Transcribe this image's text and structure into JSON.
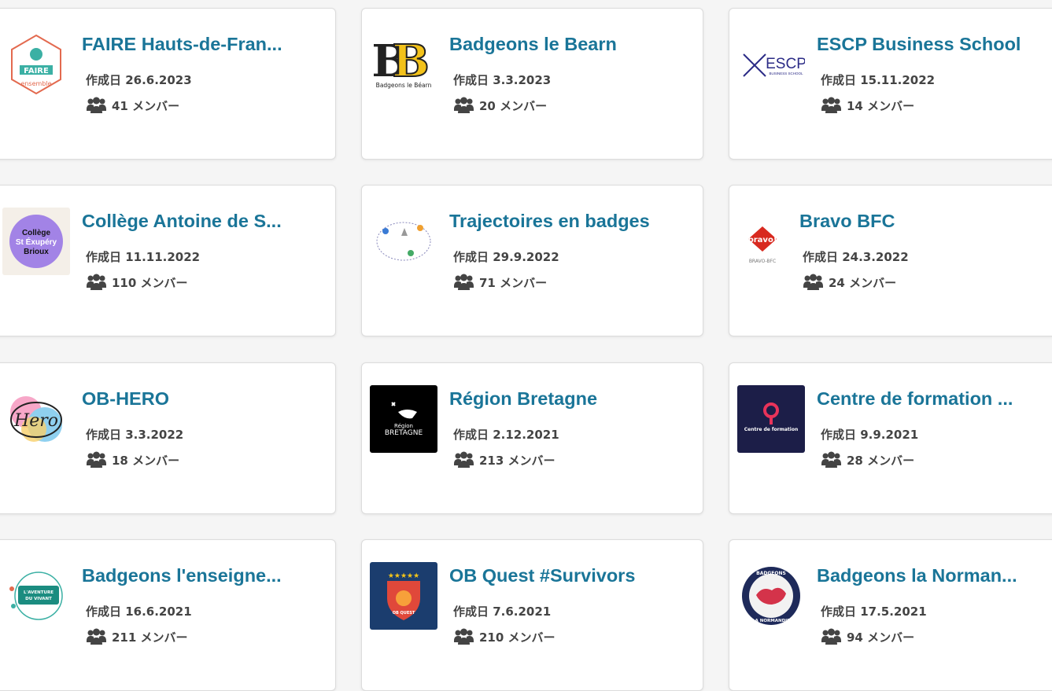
{
  "cards": [
    {
      "title": "FAIRE Hauts-de-Fran...",
      "date": "作成日 26.6.2023",
      "members": "41 メンバー",
      "logo_icon": "faire-logo-icon",
      "logo_text": "FAIRE",
      "logo_sub": "ensemble"
    },
    {
      "title": "Badgeons le Bearn",
      "date": "作成日 3.3.2023",
      "members": "20 メンバー",
      "logo_icon": "bb-logo-icon",
      "logo_text": "BB",
      "logo_sub": "Badgeons le Béarn"
    },
    {
      "title": "ESCP Business School",
      "date": "作成日 15.11.2022",
      "members": "14 メンバー",
      "logo_icon": "escp-logo-icon",
      "logo_text": "ESCP",
      "logo_sub": "BUSINESS SCHOOL"
    },
    {
      "title": "Collège Antoine de S...",
      "date": "作成日 11.11.2022",
      "members": "110 メンバー",
      "logo_icon": "college-logo-icon",
      "logo_text": "Collège St Exupéry Brioux",
      "logo_sub": ""
    },
    {
      "title": "Trajectoires en badges",
      "date": "作成日 29.9.2022",
      "members": "71 メンバー",
      "logo_icon": "trajectoires-logo-icon",
      "logo_text": "",
      "logo_sub": ""
    },
    {
      "title": "Bravo BFC",
      "date": "作成日 24.3.2022",
      "members": "24 メンバー",
      "logo_icon": "bravo-logo-icon",
      "logo_text": "bravo!",
      "logo_sub": "BRAVO-BFC"
    },
    {
      "title": "OB-HERO",
      "date": "作成日 3.3.2022",
      "members": "18 メンバー",
      "logo_icon": "hero-logo-icon",
      "logo_text": "Hero",
      "logo_sub": ""
    },
    {
      "title": "Région Bretagne",
      "date": "作成日 2.12.2021",
      "members": "213 メンバー",
      "logo_icon": "bretagne-logo-icon",
      "logo_text": "Région",
      "logo_sub": "BRETAGNE"
    },
    {
      "title": "Centre de formation ...",
      "date": "作成日 9.9.2021",
      "members": "28 メンバー",
      "logo_icon": "centre-logo-icon",
      "logo_text": "Centre de formation",
      "logo_sub": ""
    },
    {
      "title": "Badgeons l'enseigne...",
      "date": "作成日 16.6.2021",
      "members": "211 メンバー",
      "logo_icon": "aventure-logo-icon",
      "logo_text": "L'AVENTURE DU VIVANT",
      "logo_sub": ""
    },
    {
      "title": "OB Quest #Survivors",
      "date": "作成日 7.6.2021",
      "members": "210 メンバー",
      "logo_icon": "obquest-logo-icon",
      "logo_text": "OB QUEST",
      "logo_sub": ""
    },
    {
      "title": "Badgeons la Norman...",
      "date": "作成日 17.5.2021",
      "members": "94 メンバー",
      "logo_icon": "normandie-logo-icon",
      "logo_text": "BADGEONS",
      "logo_sub": "LA NORMANDIE"
    }
  ],
  "colors": {
    "title": "#1a7598",
    "text": "#444444",
    "card_bg": "#ffffff",
    "page_bg": "#f5f5f5"
  }
}
